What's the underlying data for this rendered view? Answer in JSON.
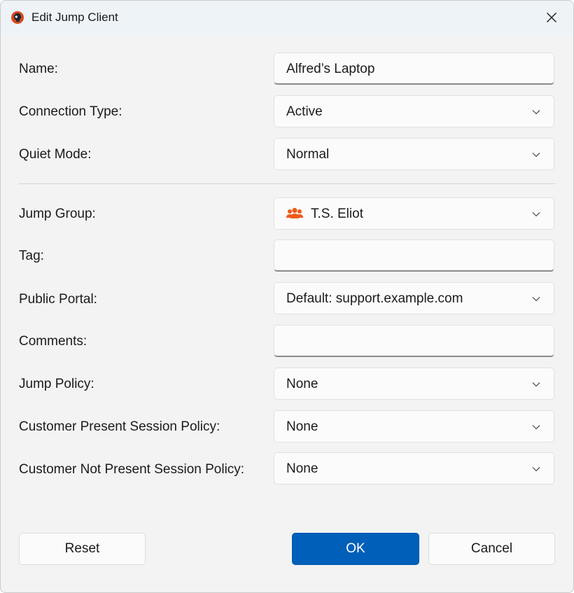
{
  "window": {
    "title": "Edit Jump Client",
    "app_icon": "bomgar-headset-icon",
    "close_icon": "close-icon"
  },
  "form": {
    "name": {
      "label": "Name:",
      "value": "Alfred’s Laptop"
    },
    "connection_type": {
      "label": "Connection Type:",
      "value": "Active"
    },
    "quiet_mode": {
      "label": "Quiet Mode:",
      "value": "Normal"
    },
    "jump_group": {
      "label": "Jump Group:",
      "value": "T.S. Eliot",
      "icon": "users-group-icon"
    },
    "tag": {
      "label": "Tag:",
      "value": ""
    },
    "public_portal": {
      "label": "Public Portal:",
      "value": "Default: support.example.com"
    },
    "comments": {
      "label": "Comments:",
      "value": ""
    },
    "jump_policy": {
      "label": "Jump Policy:",
      "value": "None"
    },
    "customer_present_policy": {
      "label": "Customer Present Session Policy:",
      "value": "None"
    },
    "customer_not_present_policy": {
      "label": "Customer Not Present Session Policy:",
      "value": "None"
    }
  },
  "buttons": {
    "reset": "Reset",
    "ok": "OK",
    "cancel": "Cancel"
  },
  "colors": {
    "accent": "#005fb8",
    "group_icon": "#f05a1a"
  }
}
